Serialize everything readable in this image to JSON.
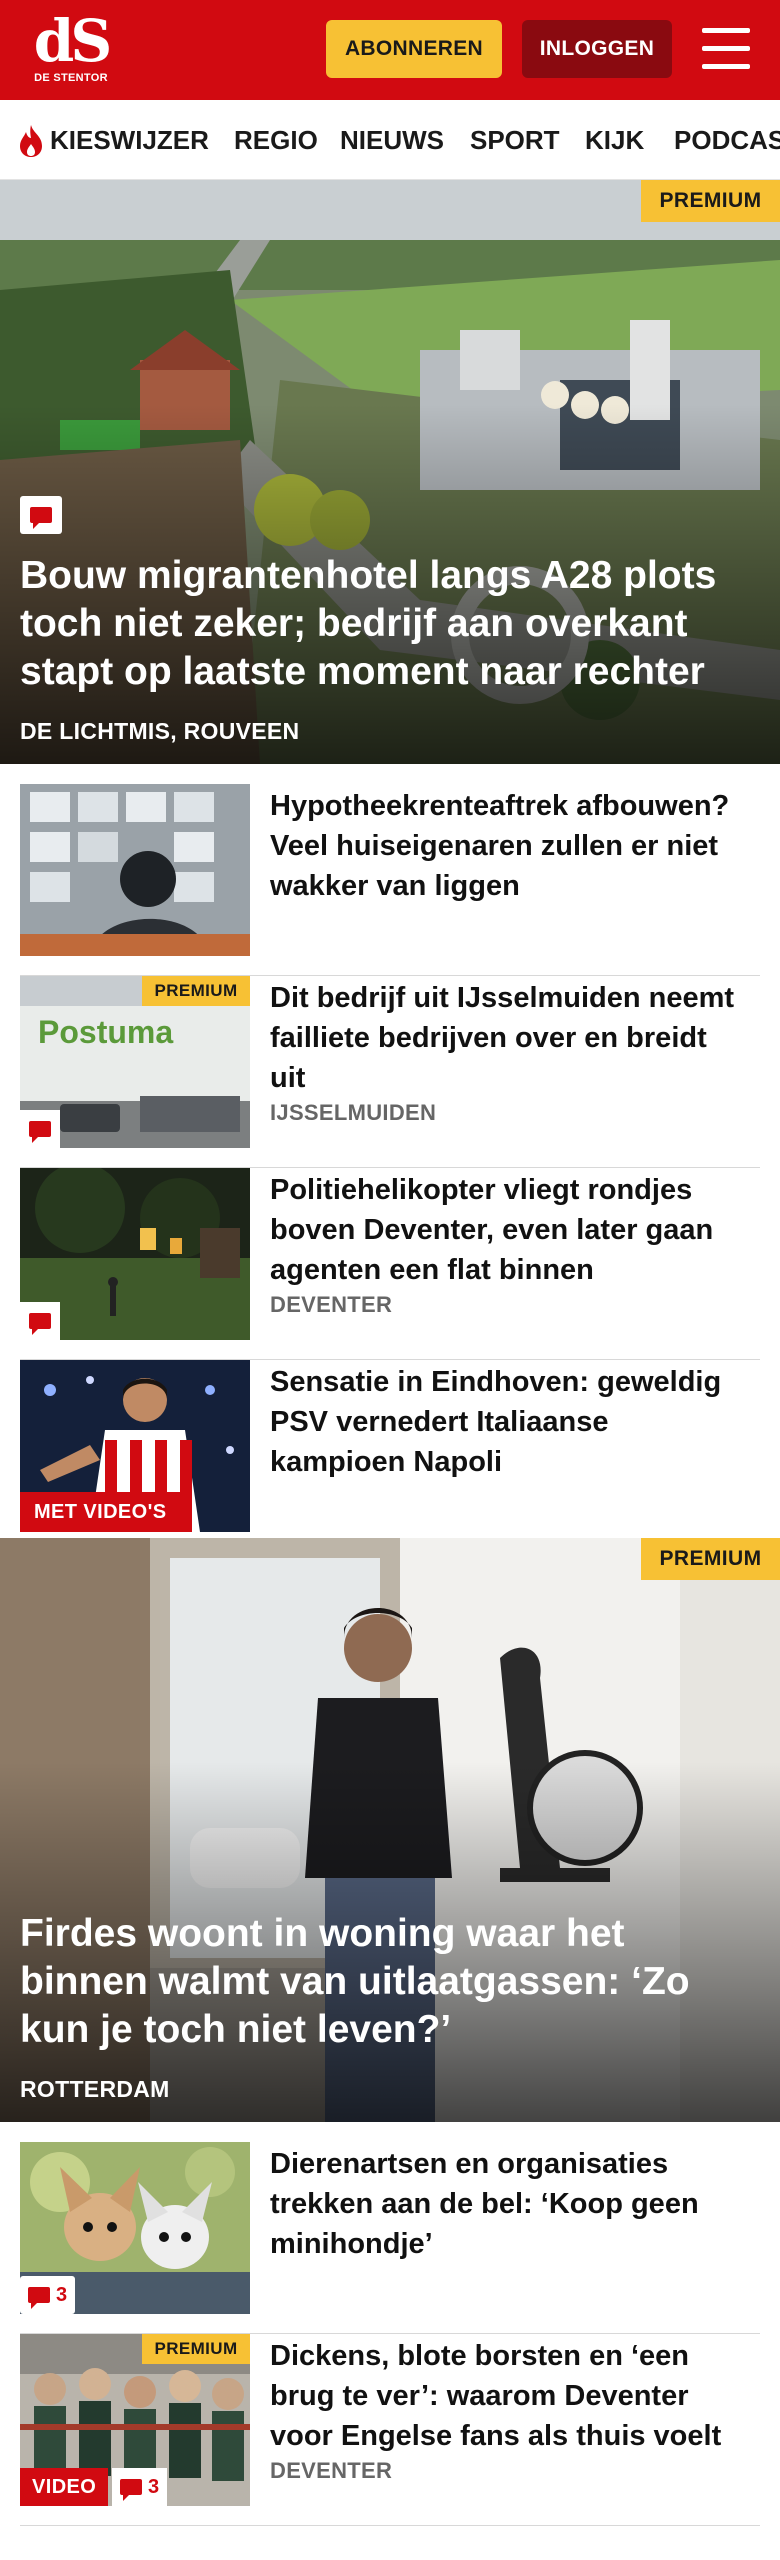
{
  "header": {
    "logo_text": "dS",
    "logo_sub": "DE STENTOR",
    "subscribe_label": "ABONNEREN",
    "login_label": "INLOGGEN"
  },
  "nav": {
    "items": [
      "KIESWIJZER",
      "REGIO",
      "NIEUWS",
      "SPORT",
      "KIJK",
      "PODCAST"
    ]
  },
  "hero1": {
    "badge": "PREMIUM",
    "title": "Bouw migrantenhotel langs A28 plots toch niet zeker; bedrijf aan overkant stapt op laatste moment naar rechter",
    "location": "DE LICHTMIS, ROUVEEN"
  },
  "articles1": [
    {
      "title": "Hypotheekrenteaftrek afbouwen? Veel huiseigenaren zullen er niet wakker van liggen",
      "location": ""
    },
    {
      "title": "Dit bedrijf uit IJsselmuiden neemt failliete bedrijven over en breidt uit",
      "location": "IJSSELMUIDEN",
      "badge": "PREMIUM",
      "thumb_sign": "Postuma"
    },
    {
      "title": "Politiehelikopter vliegt rondjes boven Deventer, even later gaan agenten een flat binnen",
      "location": "DEVENTER"
    },
    {
      "title": "Sensatie in Eindhoven: geweldig PSV vernedert Italiaanse kampioen Napoli",
      "location": "",
      "video_label": "MET VIDEO'S"
    }
  ],
  "hero2": {
    "badge": "PREMIUM",
    "title": "Firdes woont in woning waar het binnen walmt van uitlaatgassen: ‘Zo kun je toch niet leven?’",
    "location": "ROTTERDAM"
  },
  "articles2": [
    {
      "title": "Dierenartsen en organisaties trekken aan de bel: ‘Koop geen minihondje’",
      "location": "",
      "comments": "3"
    },
    {
      "title": "Dickens, blote borsten en ‘een brug te ver’: waarom Deventer voor Engelse fans als thuis voelt",
      "location": "DEVENTER",
      "badge": "PREMIUM",
      "video_label": "VIDEO",
      "comments": "3"
    }
  ],
  "colors": {
    "brand_red": "#d10a11",
    "premium_yellow": "#f7c134",
    "login_dark_red": "#8a0a10"
  }
}
